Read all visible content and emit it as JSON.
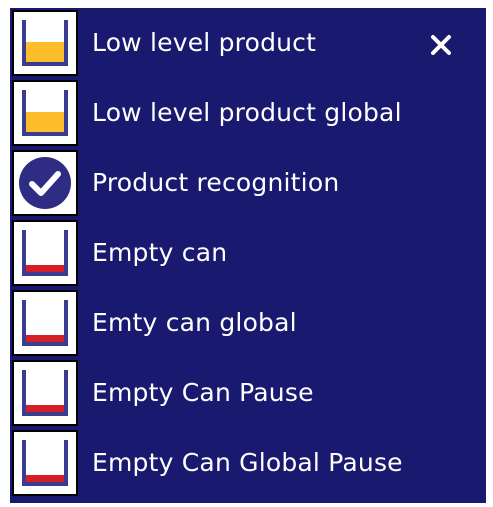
{
  "colors": {
    "panel_bg": "#191970",
    "text": "#ffffff",
    "low_level_fill": "#FDBE2B",
    "empty_fill": "#D41F28",
    "check_circle": "#2E2C83",
    "frame": "#3B3B8F"
  },
  "menu": {
    "close_icon": "close-icon",
    "items": [
      {
        "label": "Low level product",
        "icon": "low-level-icon"
      },
      {
        "label": "Low level product global",
        "icon": "low-level-icon"
      },
      {
        "label": "Product recognition",
        "icon": "checkmark-circle-icon"
      },
      {
        "label": "Empty can",
        "icon": "empty-can-icon"
      },
      {
        "label": "Emty can global",
        "icon": "empty-can-icon"
      },
      {
        "label": "Empty Can Pause",
        "icon": "empty-can-icon"
      },
      {
        "label": "Empty Can Global Pause",
        "icon": "empty-can-icon"
      }
    ]
  }
}
